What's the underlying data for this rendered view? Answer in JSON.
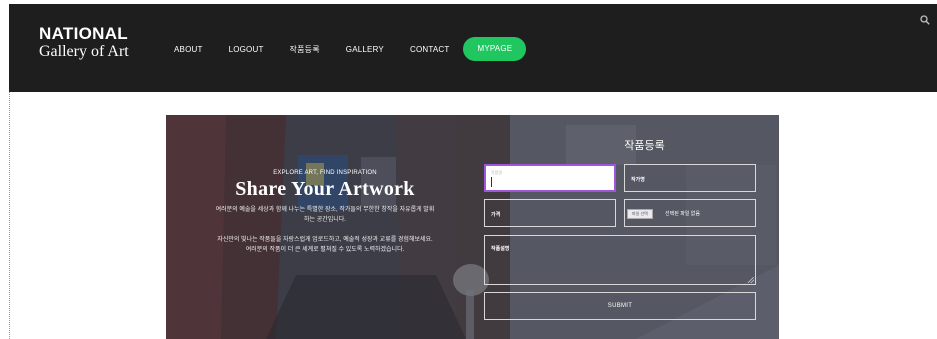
{
  "header": {
    "brand_line1": "NATIONAL",
    "brand_line2": "Gallery of Art",
    "nav": [
      {
        "label": "ABOUT",
        "active": false
      },
      {
        "label": "LOGOUT",
        "active": false
      },
      {
        "label": "작품등록",
        "active": false
      },
      {
        "label": "GALLERY",
        "active": false
      },
      {
        "label": "CONTACT",
        "active": false
      },
      {
        "label": "MYPAGE",
        "active": true
      }
    ],
    "search_icon": "search-icon"
  },
  "hero": {
    "tagline": "EXPLORE ART, FIND INSPIRATION",
    "title": "Share Your Artwork",
    "desc1": "여러분의 예술을 세상과 함께 나누는 특별한 장소, 작가들의 무한한 창작을 자유롭게 발휘",
    "desc2": "하는 공간입니다.",
    "desc3": "자신만의 빛나는 작품들을 자랑스럽게 업로드하고, 예술적 성장과 교류를 경험해보세요.",
    "desc4": "여러분의 작품이 더 큰 세계로 펼쳐질 수 있도록 노력하겠습니다."
  },
  "form": {
    "title": "작품등록",
    "title_placeholder": "작품명",
    "artist_label": "작가명",
    "price_label": "가격",
    "file_button": "파일 선택",
    "file_none": "선택된 파일 없음",
    "desc_label": "작품설명",
    "submit": "SUBMIT"
  },
  "colors": {
    "header_bg": "#1e1e1e",
    "active_nav": "#20c760",
    "focus_border": "#9f56d8"
  }
}
